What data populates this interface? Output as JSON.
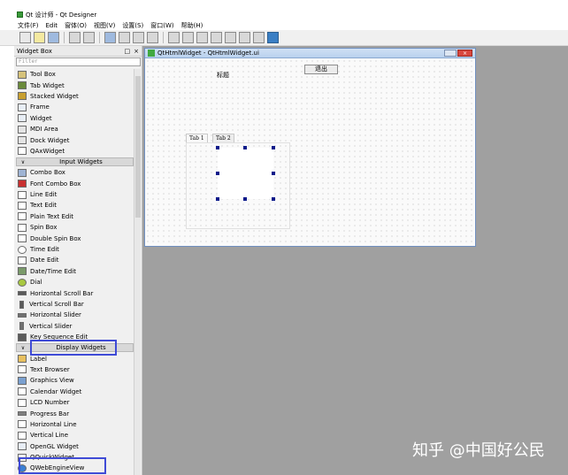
{
  "app": {
    "title": "Qt 设计师 - Qt Designer"
  },
  "menu": [
    "文件(F)",
    "Edit",
    "窗体(O)",
    "视图(V)",
    "设置(S)",
    "窗口(W)",
    "帮助(H)"
  ],
  "widget_box": {
    "title": "Widget Box",
    "filter_placeholder": "Filter",
    "items_top": [
      "Tool Box",
      "Tab Widget",
      "Stacked Widget",
      "Frame",
      "Widget",
      "MDI Area",
      "Dock Widget",
      "QAxWidget"
    ],
    "cat_input": "Input Widgets",
    "items_input": [
      "Combo Box",
      "Font Combo Box",
      "Line Edit",
      "Text Edit",
      "Plain Text Edit",
      "Spin Box",
      "Double Spin Box",
      "Time Edit",
      "Date Edit",
      "Date/Time Edit",
      "Dial",
      "Horizontal Scroll Bar",
      "Vertical Scroll Bar",
      "Horizontal Slider",
      "Vertical Slider",
      "Key Sequence Edit"
    ],
    "cat_display": "Display Widgets",
    "items_display": [
      "Label",
      "Text Browser",
      "Graphics View",
      "Calendar Widget",
      "LCD Number",
      "Progress Bar",
      "Horizontal Line",
      "Vertical Line",
      "OpenGL Widget",
      "QQuickWidget",
      "QWebEngineView"
    ]
  },
  "form": {
    "title": "QtHtmlWidget - QtHtmlWidget.ui",
    "label": "标题",
    "exit_button": "退出",
    "tab1": "Tab 1",
    "tab2": "Tab 2"
  },
  "watermark": "知乎 @中国好公民",
  "colors": {
    "highlight": "#3f4bd6",
    "canvas_bg": "#a0a0a0",
    "selection_handle": "#0b1a8a"
  }
}
